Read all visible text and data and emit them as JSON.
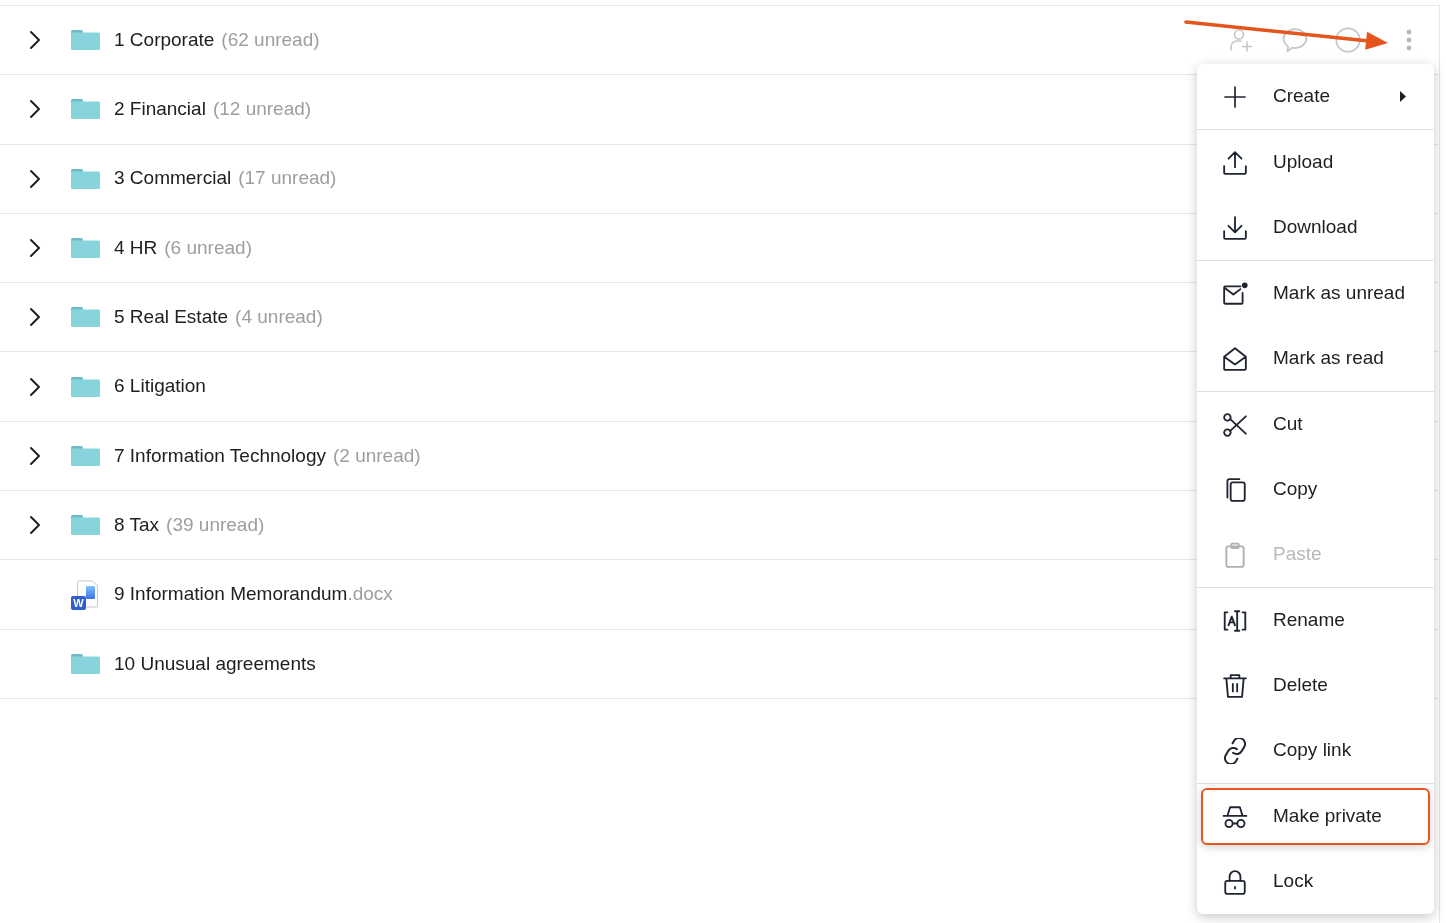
{
  "file_list": {
    "rows": [
      {
        "kind": "folder",
        "name": "1 Corporate",
        "unread": "(62 unread)",
        "expanded": false,
        "hovered": true
      },
      {
        "kind": "folder",
        "name": "2 Financial",
        "unread": "(12 unread)",
        "expanded": false
      },
      {
        "kind": "folder",
        "name": "3 Commercial",
        "unread": "(17 unread)",
        "expanded": false
      },
      {
        "kind": "folder",
        "name": "4 HR",
        "unread": "(6 unread)",
        "expanded": false
      },
      {
        "kind": "folder",
        "name": "5 Real Estate",
        "unread": "(4 unread)",
        "expanded": false
      },
      {
        "kind": "folder",
        "name": "6 Litigation",
        "expanded": false
      },
      {
        "kind": "folder",
        "name": "7 Information Technology",
        "unread": "(2 unread)",
        "expanded": false
      },
      {
        "kind": "folder",
        "name": "8 Tax",
        "unread": "(39 unread)",
        "expanded": false
      },
      {
        "kind": "document",
        "name": "9 Information Memorandum",
        "extension": ".docx",
        "file_badge": "W"
      },
      {
        "kind": "folder",
        "name": "10 Unusual agreements"
      }
    ]
  },
  "context_menu": {
    "groups": [
      {
        "items": [
          {
            "label": "Create",
            "submenu": true,
            "disabled": false,
            "highlighted": false
          }
        ]
      },
      {
        "items": [
          {
            "label": "Upload",
            "submenu": false,
            "disabled": false,
            "highlighted": false
          },
          {
            "label": "Download",
            "submenu": false,
            "disabled": false,
            "highlighted": false
          }
        ]
      },
      {
        "items": [
          {
            "label": "Mark as unread",
            "submenu": false,
            "disabled": false,
            "highlighted": false
          },
          {
            "label": "Mark as read",
            "submenu": false,
            "disabled": false,
            "highlighted": false
          }
        ]
      },
      {
        "items": [
          {
            "label": "Cut",
            "submenu": false,
            "disabled": false,
            "highlighted": false
          },
          {
            "label": "Copy",
            "submenu": false,
            "disabled": false,
            "highlighted": false
          },
          {
            "label": "Paste",
            "submenu": false,
            "disabled": true,
            "highlighted": false
          }
        ]
      },
      {
        "items": [
          {
            "label": "Rename",
            "submenu": false,
            "disabled": false,
            "highlighted": false
          },
          {
            "label": "Delete",
            "submenu": false,
            "disabled": false,
            "highlighted": false
          },
          {
            "label": "Copy link",
            "submenu": false,
            "disabled": false,
            "highlighted": false
          }
        ]
      },
      {
        "items": [
          {
            "label": "Make private",
            "submenu": false,
            "disabled": false,
            "highlighted": true
          },
          {
            "label": "Lock",
            "submenu": false,
            "disabled": false,
            "highlighted": false
          }
        ]
      }
    ]
  }
}
